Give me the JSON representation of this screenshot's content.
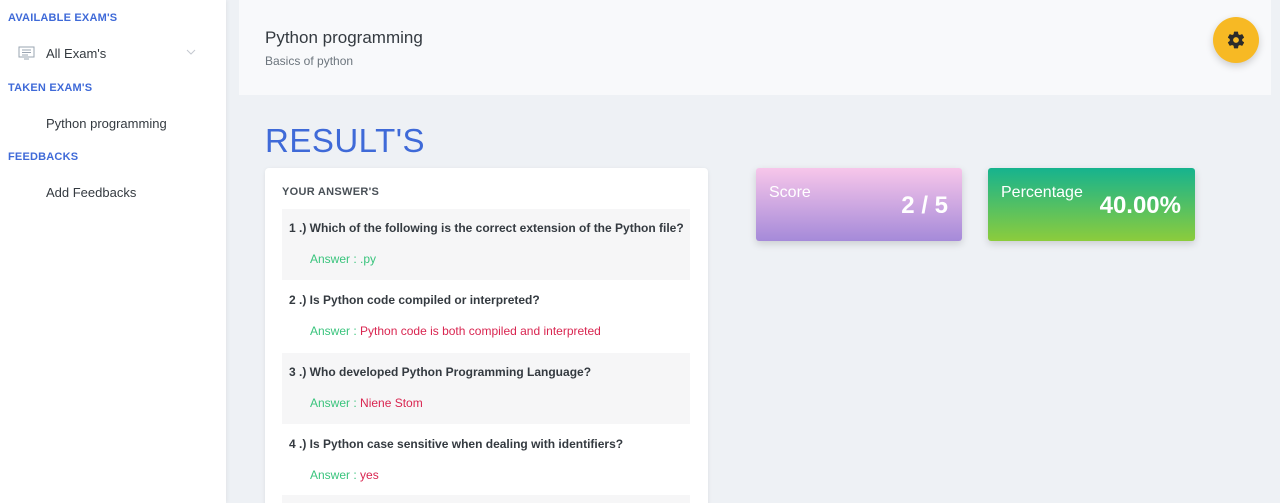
{
  "sidebar": {
    "available_heading": "AVAILABLE EXAM'S",
    "all_exams_label": "All Exam's",
    "taken_heading": "TAKEN EXAM'S",
    "taken_item": "Python programming",
    "feedbacks_heading": "FEEDBACKS",
    "add_feedbacks_label": "Add Feedbacks"
  },
  "header": {
    "title": "Python programming",
    "subtitle": "Basics of python"
  },
  "results": {
    "title": "RESULT'S",
    "answers_heading": "YOUR ANSWER'S",
    "questions": [
      {
        "question": "1 .) Which of the following is the correct extension of the Python file?",
        "answer_label": "Answer :",
        "answer": ".py",
        "status": "correct"
      },
      {
        "question": "2 .) Is Python code compiled or interpreted?",
        "answer_label": "Answer :",
        "answer": "Python code is both compiled and interpreted",
        "status": "wrong"
      },
      {
        "question": "3 .) Who developed Python Programming Language?",
        "answer_label": "Answer :",
        "answer": "Niene Stom",
        "status": "wrong"
      },
      {
        "question": "4 .) Is Python case sensitive when dealing with identifiers?",
        "answer_label": "Answer :",
        "answer": "yes",
        "status": "wrong"
      }
    ]
  },
  "stats": {
    "score_label": "Score",
    "score_value": "2 / 5",
    "percentage_label": "Percentage",
    "percentage_value": "40.00%"
  },
  "colors": {
    "accent": "#3f6ad8",
    "correct": "#3ac47d",
    "wrong": "#d92550",
    "gear_button": "#f7b924"
  },
  "icons": {
    "all_exams": "monitor-list-icon",
    "expand": "chevron-down-icon",
    "settings": "gear-icon"
  }
}
